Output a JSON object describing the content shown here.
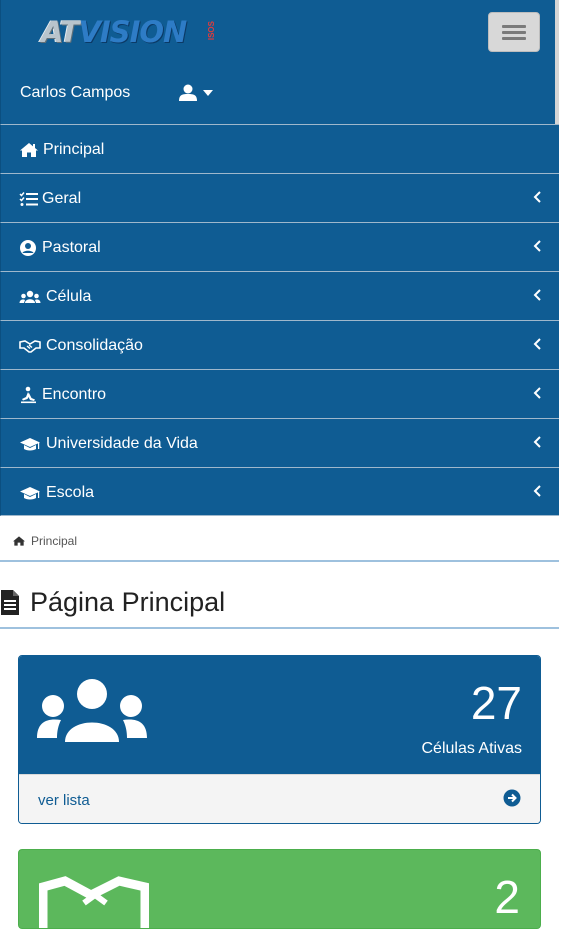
{
  "header": {
    "logo_text": "ATVISION",
    "logo_tag": "ISOS",
    "user_name": "Carlos Campos",
    "menu_toggle_label": "Toggle navigation"
  },
  "nav": {
    "items": [
      {
        "label": "Principal",
        "icon": "home-icon",
        "has_submenu": false
      },
      {
        "label": "Geral",
        "icon": "list-check-icon",
        "has_submenu": true
      },
      {
        "label": "Pastoral",
        "icon": "user-circle-icon",
        "has_submenu": true
      },
      {
        "label": "Célula",
        "icon": "users-icon",
        "has_submenu": true
      },
      {
        "label": "Consolidação",
        "icon": "handshake-icon",
        "has_submenu": true
      },
      {
        "label": "Encontro",
        "icon": "person-praying-icon",
        "has_submenu": true
      },
      {
        "label": "Universidade da Vida",
        "icon": "graduation-cap-icon",
        "has_submenu": true
      },
      {
        "label": "Escola",
        "icon": "graduation-cap-icon",
        "has_submenu": true
      }
    ]
  },
  "breadcrumb": {
    "label": "Principal"
  },
  "page": {
    "title": "Página Principal"
  },
  "cards": [
    {
      "count": "27",
      "caption": "Células Ativas",
      "link": "ver lista",
      "color": "#0f5c93"
    },
    {
      "count": "2",
      "color": "#5cb85c"
    }
  ],
  "colors": {
    "primary": "#0f5c93",
    "success": "#5cb85c",
    "rule": "#9ec1de"
  }
}
